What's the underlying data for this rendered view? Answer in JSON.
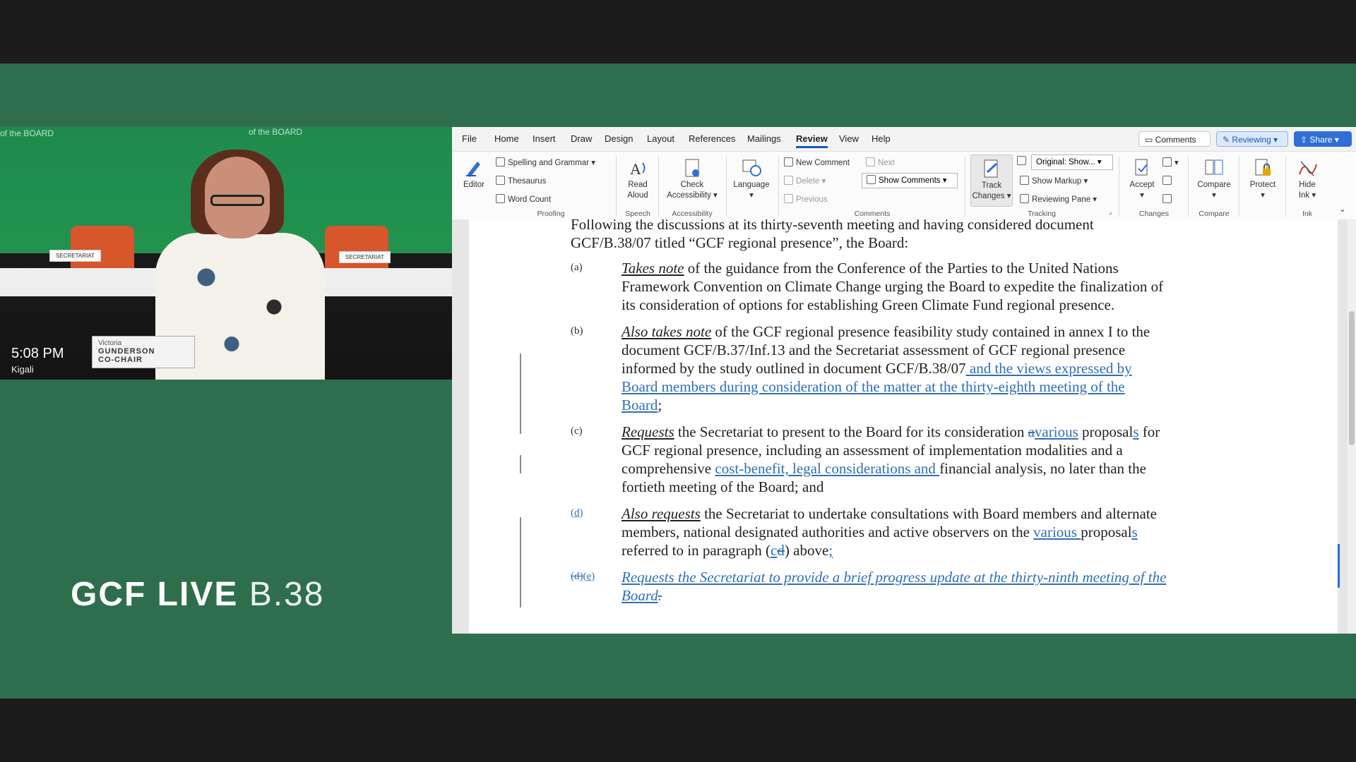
{
  "video": {
    "backdrop_text_1": "of the BOARD",
    "backdrop_text_2": "of the BOARD",
    "card_left": "SECRETARIAT",
    "card_right": "SECRETARIAT",
    "nameplate_first": "Victoria",
    "nameplate_last": "GUNDERSON",
    "nameplate_role": "CO-CHAIR",
    "time": "5:08 PM",
    "location": "Kigali"
  },
  "branding": {
    "logo_bold": "GCF LIVE",
    "logo_light": "B.38"
  },
  "word": {
    "menu_tabs": [
      "File",
      "Home",
      "Insert",
      "Draw",
      "Design",
      "Layout",
      "References",
      "Mailings",
      "Review",
      "View",
      "Help"
    ],
    "active_tab": "Review",
    "top_buttons": {
      "comments": "Comments",
      "reviewing": "Reviewing",
      "share": "Share"
    },
    "ribbon": {
      "editor": "Editor",
      "spelling": "Spelling and Grammar",
      "thesaurus": "Thesaurus",
      "word_count": "Word Count",
      "proofing": "Proofing",
      "read_aloud_1": "Read",
      "read_aloud_2": "Aloud",
      "speech": "Speech",
      "check_acc_1": "Check",
      "check_acc_2": "Accessibility",
      "accessibility": "Accessibility",
      "language": "Language",
      "new_comment": "New Comment",
      "delete": "Delete",
      "previous": "Previous",
      "next": "Next",
      "show_comments": "Show Comments",
      "comments_group": "Comments",
      "track_1": "Track",
      "track_2": "Changes",
      "markup_dropdown": "Original: Show...",
      "show_markup": "Show Markup",
      "reviewing_pane": "Reviewing Pane",
      "tracking": "Tracking",
      "accept": "Accept",
      "changes": "Changes",
      "compare_btn": "Compare",
      "compare_group": "Compare",
      "protect": "Protect",
      "hide_ink_1": "Hide",
      "hide_ink_2": "Ink",
      "ink": "Ink"
    },
    "document": {
      "intro_1": "Following the discussions at its thirty-seventh meeting and having considered document",
      "intro_2": "GCF/B.38/07 titled “GCF regional presence”, the Board:",
      "a_label": "(a)",
      "a_lead": "Takes note",
      "a_1": " of the guidance from the Conference of the Parties to the United Nations",
      "a_2": "Framework Convention on Climate Change urging the Board to expedite the finalization of",
      "a_3": "its consideration of options for establishing Green Climate Fund regional presence.",
      "b_label": "(b)",
      "b_lead": "Also takes note",
      "b_1": " of the GCF regional presence feasibility study contained in annex I to the",
      "b_2": "document GCF/B.37/Inf.13 and the Secretariat assessment of GCF regional presence",
      "b_3": "informed by the study outlined in document GCF/B.38/07",
      "b_3_ins": " and the views expressed by",
      "b_4_ins": "Board members during consideration of the matter at the thirty-eighth meeting of the",
      "b_5_ins": "Board",
      "b_5_end": ";",
      "c_label": "(c)",
      "c_lead": "Requests",
      "c_1": " the Secretariat to present to the Board for its consideration ",
      "c_1_del": "a",
      "c_1_ins": "various",
      "c_1_b": " proposal",
      "c_1_ins2": "s",
      "c_1_c": " for",
      "c_2": "GCF regional presence, including an assessment of implementation modalities and a",
      "c_3a": "comprehensive ",
      "c_3_ins": "cost-benefit, legal considerations and ",
      "c_3b": "financial analysis, no later than the",
      "c_4": "fortieth meeting of the Board; and",
      "d_label": "(d)",
      "d_lead": "Also requests",
      "d_1": " the Secretariat to undertake consultations with Board members and alternate",
      "d_2a": "members, national designated authorities and active observers on the ",
      "d_2_ins": "various ",
      "d_2b": "proposal",
      "d_2_ins2": "s",
      "d_3a": "referred to in paragraph (",
      "d_3_ins": "c",
      "d_3_del": "d",
      "d_3b": ") above",
      "d_3_ins2": ";",
      "e_label_del": "(d)",
      "e_label_ins": "(e)",
      "e_1": "Requests the Secretariat to provide a brief progress update at the thirty-ninth meeting of the",
      "e_2": "Board",
      "e_2_del": "."
    }
  }
}
